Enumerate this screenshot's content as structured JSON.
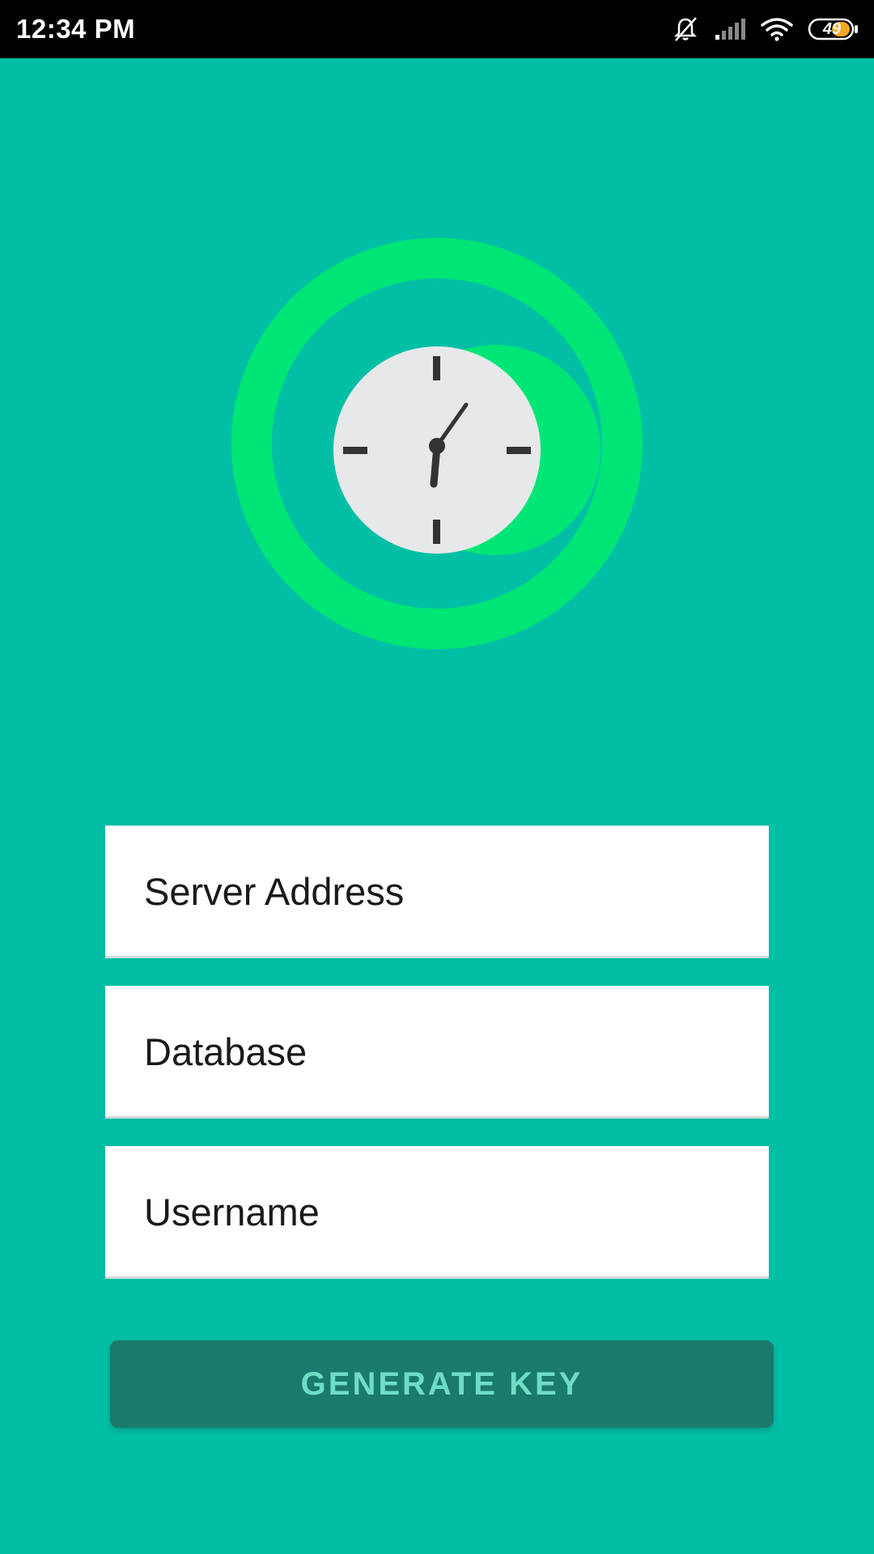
{
  "status_bar": {
    "time": "12:34 PM",
    "battery_level": "49",
    "icons": [
      "bell-muted-icon",
      "signal-icon",
      "wifi-icon",
      "battery-icon"
    ]
  },
  "logo": {
    "icon": "clock-icon"
  },
  "form": {
    "server_address_placeholder": "Server Address",
    "database_placeholder": "Database",
    "username_placeholder": "Username"
  },
  "actions": {
    "generate_key_label": "GENERATE KEY"
  },
  "colors": {
    "background": "#00BFA5",
    "ring": "#00E676",
    "clock_face": "#E6E8EA",
    "clock_hands": "#333333",
    "button": "#1A7A6B",
    "button_text": "#6FDCC6",
    "status_bar": "#000000"
  }
}
